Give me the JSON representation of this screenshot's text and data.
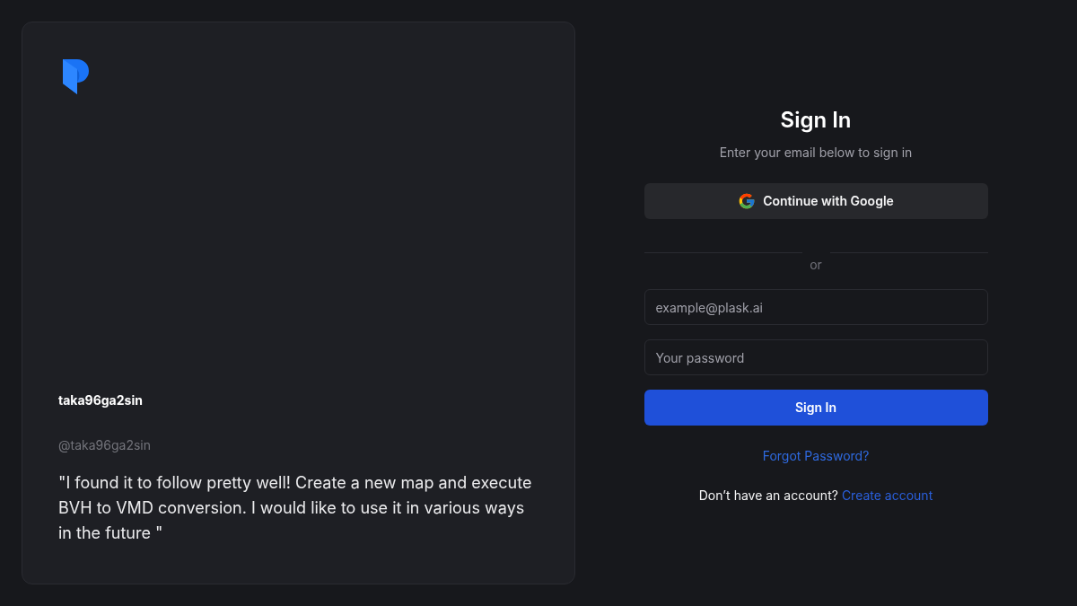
{
  "testimonial": {
    "name": "taka96ga2sin",
    "handle": "@taka96ga2sin",
    "quote": "\"I found it to follow pretty well! Create a new map and execute BVH to VMD conversion. I would like to use it in various ways in the future \""
  },
  "sign_in": {
    "title": "Sign In",
    "subtitle": "Enter your email below to sign in",
    "google_button": "Continue with Google",
    "divider": "or",
    "fields": [
      {
        "placeholder": "example@plask.ai"
      },
      {
        "placeholder": "Your password"
      }
    ],
    "submit": "Sign In",
    "forgot_link": "Forgot Password?",
    "signup_prompt": "Don’t have an account?",
    "signup_link": "Create account"
  }
}
